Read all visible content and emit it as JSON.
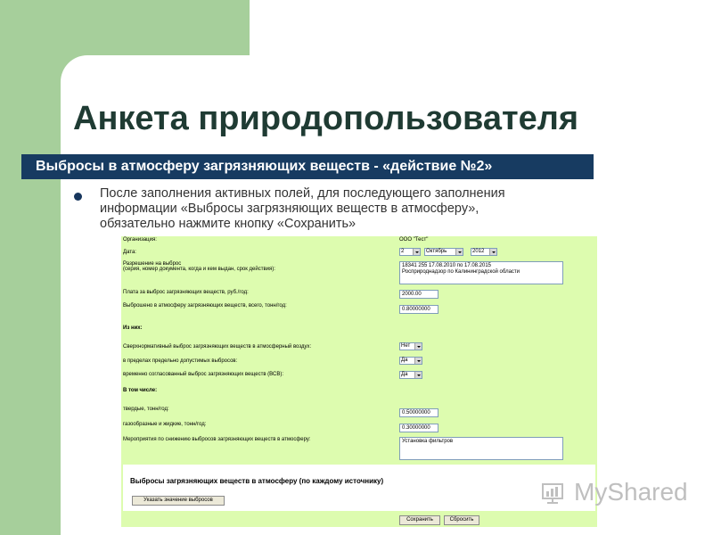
{
  "slide": {
    "title": "Анкета природопользователя",
    "banner": "Выбросы в атмосферу загрязняющих веществ - «действие №2»",
    "bullet_line1": "После заполнения активных полей, для последующего заполнения",
    "bullet_line2": "информации «Выбросы загрязняющих веществ в атмосферу»,",
    "bullet_line3": "обязательно нажмите кнопку «Сохранить»"
  },
  "form": {
    "organization_label": "Организация:",
    "organization_value": "ООО \"Тест\"",
    "date_label": "Дата:",
    "date_day": "2",
    "date_month": "Октябрь",
    "date_year": "2012",
    "permit_label": "Разрешение на выброс",
    "permit_hint": "(серия, номер документа, когда и кем выдан, срок действия):",
    "permit_value_line1": "18341 255 17.08.2010 по 17.08.2015",
    "permit_value_line2": "Росприроднадзор по Калининградской области",
    "fee_label": "Плата за выброс загрязняющих веществ, руб./год:",
    "fee_value": "2000.00",
    "total_label": "Выброшено в атмосферу загрязняющих веществ, всего, тонн/год:",
    "total_value": "0.80000000",
    "of_them_label": "Из них:",
    "excess_label": "Сверхнормативный выброс загрязняющих веществ в атмосферный воздух:",
    "excess_value": "Нет",
    "within_limits_label": "в пределах предельно допустимых выбросов:",
    "within_limits_value": "Да",
    "temp_agreed_label": "временно согласованный выброс загрязняющих веществ (ВСВ):",
    "temp_agreed_value": "Да",
    "including_label": "В том числе:",
    "solid_label": "твердые, тонн/год:",
    "solid_value": "0.50000000",
    "gas_liquid_label": "газообразные и жидкие, тонн/год:",
    "gas_liquid_value": "0.30000000",
    "measures_label": "Мероприятия по снижению выбросов загрязняющих веществ в атмосферу:",
    "measures_value": "Установка фильтров",
    "sub_title": "Выбросы загрязняющих веществ в атмосферу (по каждому источнику)",
    "specify_button": "Указать значение выбросов",
    "save_button": "Сохранить",
    "reset_button": "Сбросить"
  },
  "watermark": {
    "text": "MyShared"
  },
  "icons": {
    "bullet": "bullet-dot",
    "dropdown": "chevron-down-icon",
    "watermark": "logo-icon"
  },
  "colors": {
    "banner": "#173b61",
    "form_bg": "#ddfcaf",
    "side_green": "#a6cf9b",
    "title": "#1f3b33"
  }
}
